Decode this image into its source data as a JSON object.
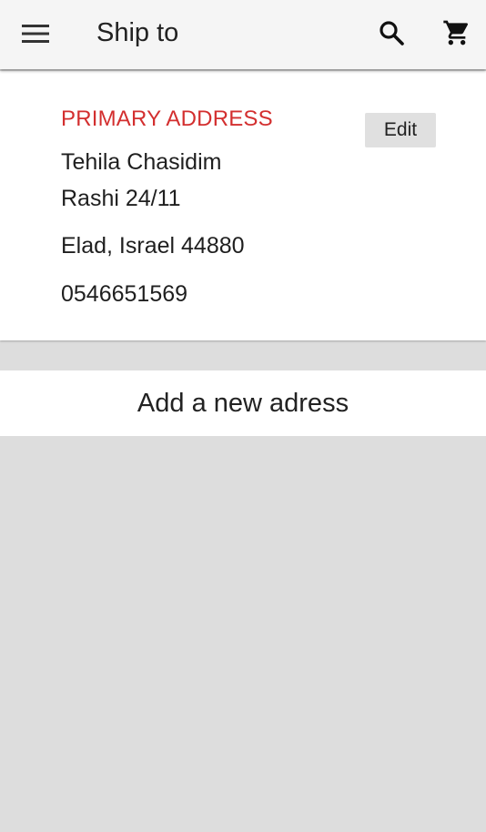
{
  "app_bar": {
    "menu_icon": "hamburger-menu-icon",
    "title": "Ship to",
    "search_icon": "search-icon",
    "cart_icon": "shopping-cart-icon"
  },
  "address_card": {
    "label": "PRIMARY ADDRESS",
    "label_color": "#d32f2f",
    "name": "Tehila Chasidim",
    "street": "Rashi 24/11",
    "city_line": "Elad, Israel 44880",
    "phone": "0546651569",
    "edit_label": "Edit"
  },
  "add_address": {
    "label": "Add a new adress"
  }
}
